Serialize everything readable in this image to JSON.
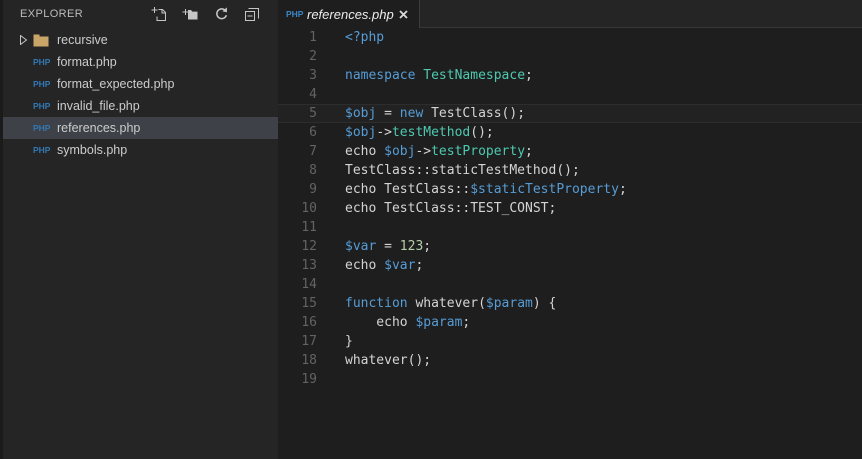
{
  "sidebar": {
    "title": "EXPLORER",
    "actions": [
      {
        "name": "new-file"
      },
      {
        "name": "new-folder"
      },
      {
        "name": "refresh"
      },
      {
        "name": "collapse-all"
      }
    ],
    "file_icon_text": "PHP",
    "items": [
      {
        "label": "recursive",
        "type": "folder",
        "expanded": false,
        "selected": false
      },
      {
        "label": "format.php",
        "type": "php-file",
        "selected": false
      },
      {
        "label": "format_expected.php",
        "type": "php-file",
        "selected": false
      },
      {
        "label": "invalid_file.php",
        "type": "php-file",
        "selected": false
      },
      {
        "label": "references.php",
        "type": "php-file",
        "selected": true
      },
      {
        "label": "symbols.php",
        "type": "php-file",
        "selected": false
      }
    ]
  },
  "editor": {
    "tab": {
      "icon_text": "PHP",
      "label": "references.php"
    },
    "current_line": 5,
    "colors": {
      "fg": "#d4d4d4",
      "keyword": "#569cd6",
      "type": "#4ec9b0",
      "number": "#b5cea8",
      "line_number": "#636363"
    },
    "lines": [
      [
        [
          "keyword",
          "<?php"
        ]
      ],
      [],
      [
        [
          "keyword",
          "namespace"
        ],
        [
          "fg",
          " "
        ],
        [
          "type",
          "TestNamespace"
        ],
        [
          "fg",
          ";"
        ]
      ],
      [],
      [
        [
          "keyword",
          "$obj"
        ],
        [
          "fg",
          " = "
        ],
        [
          "keyword",
          "new"
        ],
        [
          "fg",
          " TestClass();"
        ]
      ],
      [
        [
          "keyword",
          "$obj"
        ],
        [
          "fg",
          "->"
        ],
        [
          "type",
          "testMethod"
        ],
        [
          "fg",
          "();"
        ]
      ],
      [
        [
          "fg",
          "echo "
        ],
        [
          "keyword",
          "$obj"
        ],
        [
          "fg",
          "->"
        ],
        [
          "type",
          "testProperty"
        ],
        [
          "fg",
          ";"
        ]
      ],
      [
        [
          "fg",
          "TestClass::staticTestMethod();"
        ]
      ],
      [
        [
          "fg",
          "echo TestClass::"
        ],
        [
          "keyword",
          "$staticTestProperty"
        ],
        [
          "fg",
          ";"
        ]
      ],
      [
        [
          "fg",
          "echo TestClass::TEST_CONST;"
        ]
      ],
      [],
      [
        [
          "keyword",
          "$var"
        ],
        [
          "fg",
          " = "
        ],
        [
          "number",
          "123"
        ],
        [
          "fg",
          ";"
        ]
      ],
      [
        [
          "fg",
          "echo "
        ],
        [
          "keyword",
          "$var"
        ],
        [
          "fg",
          ";"
        ]
      ],
      [],
      [
        [
          "keyword",
          "function"
        ],
        [
          "fg",
          " whatever("
        ],
        [
          "keyword",
          "$param"
        ],
        [
          "fg",
          ") {"
        ]
      ],
      [
        [
          "fg",
          "    echo "
        ],
        [
          "keyword",
          "$param"
        ],
        [
          "fg",
          ";"
        ]
      ],
      [
        [
          "fg",
          "}"
        ]
      ],
      [
        [
          "fg",
          "whatever();"
        ]
      ],
      []
    ]
  }
}
